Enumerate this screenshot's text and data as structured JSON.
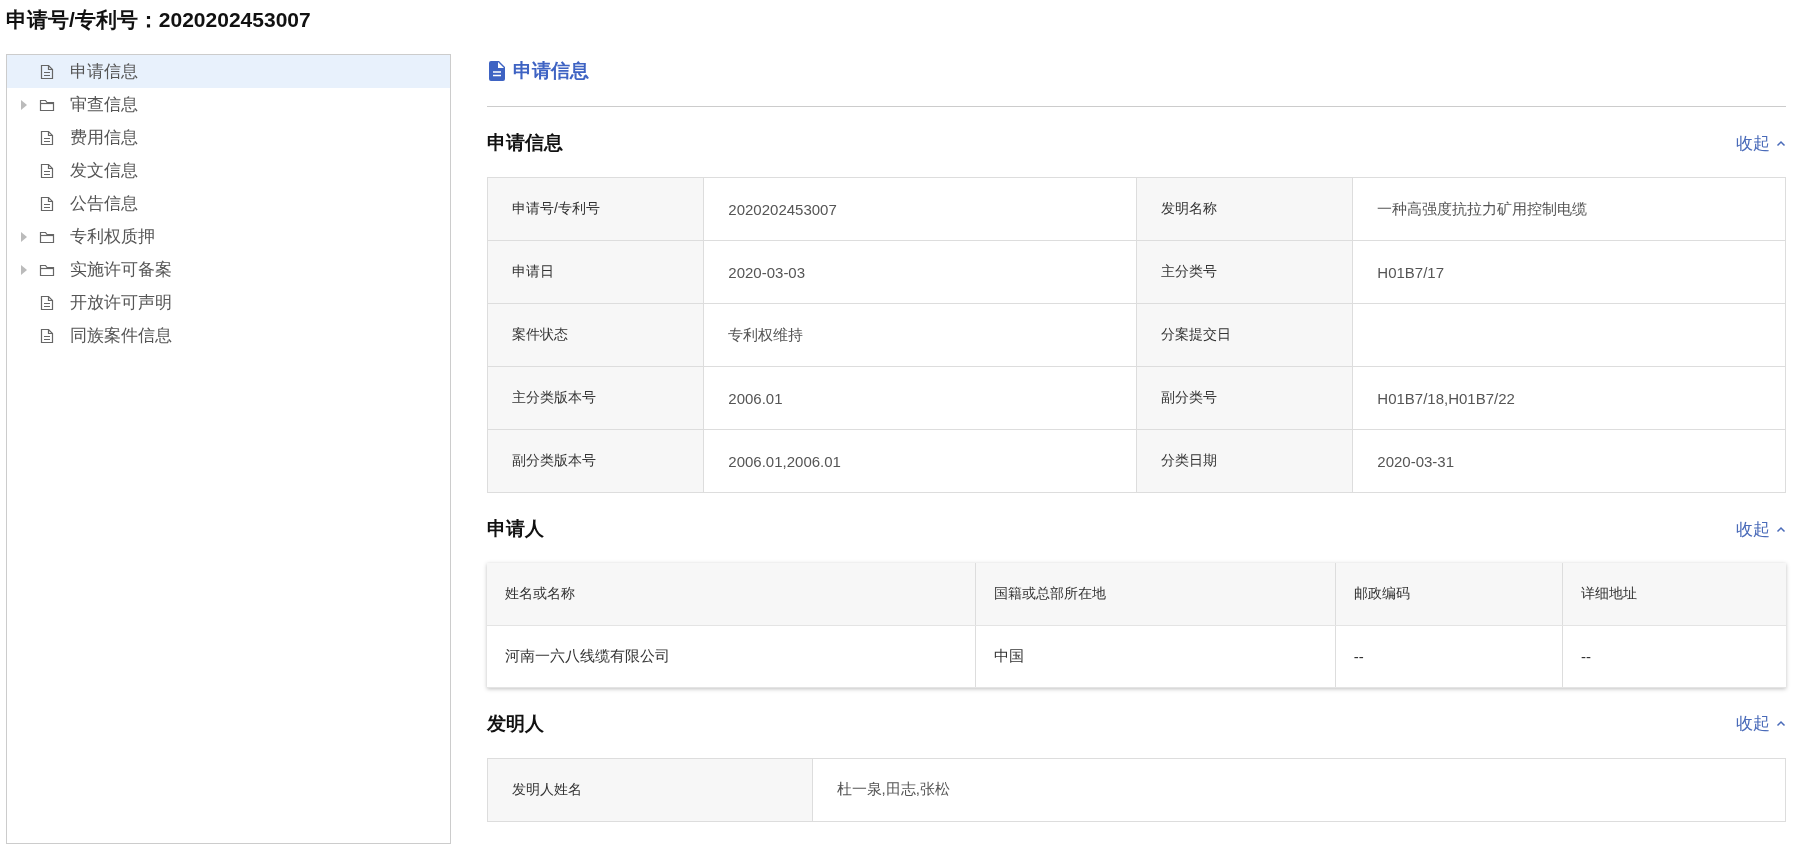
{
  "page_title": "申请号/专利号：2020202453007",
  "sidebar": {
    "items": [
      {
        "label": "申请信息",
        "kind": "file",
        "selected": true
      },
      {
        "label": "审查信息",
        "kind": "folder",
        "expanded": false,
        "selected": false
      },
      {
        "label": "费用信息",
        "kind": "file",
        "selected": false
      },
      {
        "label": "发文信息",
        "kind": "file",
        "selected": false
      },
      {
        "label": "公告信息",
        "kind": "file",
        "selected": false
      },
      {
        "label": "专利权质押",
        "kind": "folder",
        "expanded": false,
        "selected": false
      },
      {
        "label": "实施许可备案",
        "kind": "folder",
        "expanded": false,
        "selected": false
      },
      {
        "label": "开放许可声明",
        "kind": "file",
        "selected": false
      },
      {
        "label": "同族案件信息",
        "kind": "file",
        "selected": false
      }
    ]
  },
  "content": {
    "heading": "申请信息",
    "sections": [
      {
        "title": "申请信息",
        "toggle": "收起",
        "kind": "pairs",
        "rows": [
          [
            "申请号/专利号",
            "2020202453007",
            "发明名称",
            "一种高强度抗拉力矿用控制电缆"
          ],
          [
            "申请日",
            "2020-03-03",
            "主分类号",
            "H01B7/17"
          ],
          [
            "案件状态",
            "专利权维持",
            "分案提交日",
            null
          ],
          [
            "主分类版本号",
            "2006.01",
            "副分类号",
            "H01B7/18,H01B7/22"
          ],
          [
            "副分类版本号",
            "2006.01,2006.01",
            "分类日期",
            "2020-03-31"
          ]
        ]
      },
      {
        "title": "申请人",
        "toggle": "收起",
        "kind": "grid",
        "columns": [
          "姓名或名称",
          "国籍或总部所在地",
          "邮政编码",
          "详细地址"
        ],
        "rows": [
          [
            "河南一六八线缆有限公司",
            "中国",
            "--",
            "--"
          ]
        ]
      },
      {
        "title": "发明人",
        "toggle": "收起",
        "kind": "pairs",
        "rows": [
          [
            "发明人姓名",
            "杜一泉,田志,张松"
          ]
        ]
      }
    ]
  }
}
